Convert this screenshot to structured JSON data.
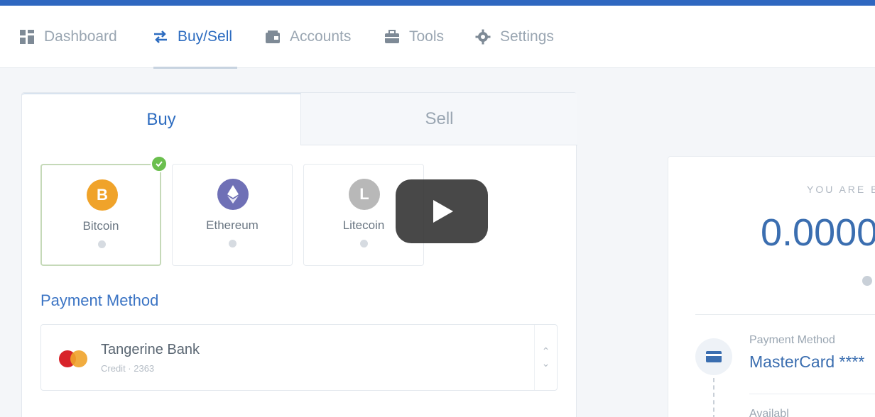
{
  "nav": {
    "items": [
      {
        "label": "Dashboard",
        "icon": "dashboard-icon"
      },
      {
        "label": "Buy/Sell",
        "icon": "swap-icon",
        "active": true
      },
      {
        "label": "Accounts",
        "icon": "wallet-icon"
      },
      {
        "label": "Tools",
        "icon": "briefcase-icon"
      },
      {
        "label": "Settings",
        "icon": "gear-icon"
      }
    ]
  },
  "tabs": {
    "buy": "Buy",
    "sell": "Sell",
    "active": "Buy"
  },
  "coins": [
    {
      "name": "Bitcoin",
      "symbol": "B",
      "color": "#f0a32a",
      "selected": true
    },
    {
      "name": "Ethereum",
      "symbol": "eth-icon",
      "color": "#6f70b6"
    },
    {
      "name": "Litecoin",
      "symbol": "L",
      "color": "#b8b8b8"
    }
  ],
  "payment": {
    "label": "Payment Method",
    "bank": "Tangerine Bank",
    "sub": "Credit · 2363"
  },
  "summary": {
    "title": "YOU ARE B",
    "amount": "0.0000",
    "payment_label": "Payment Method",
    "payment_value": "MasterCard ****",
    "available_label": "Availabl"
  },
  "colors": {
    "accent": "#2d6cc0",
    "topbar": "#2f67c0",
    "check": "#6bbf4e"
  },
  "video": {
    "control": "play-button"
  }
}
